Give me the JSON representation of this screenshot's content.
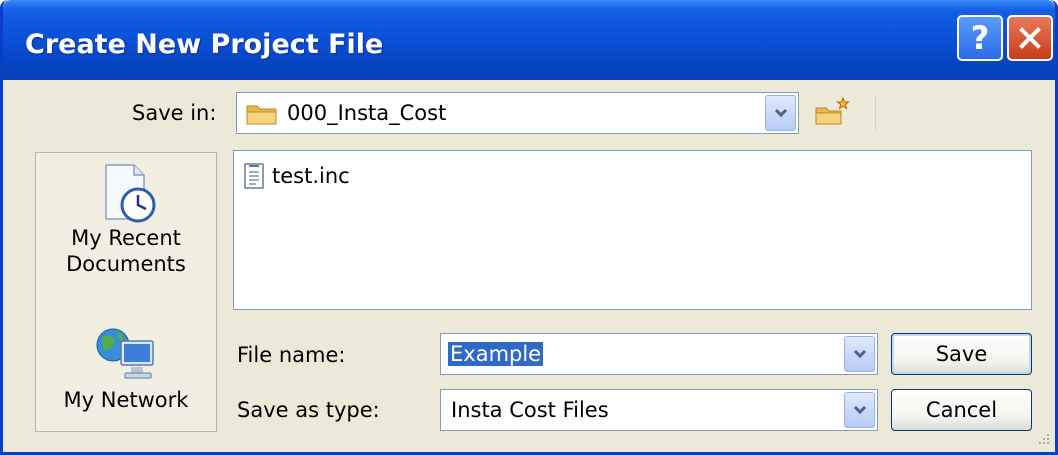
{
  "window": {
    "title": "Create New Project File",
    "help_label": "?",
    "colors": {
      "title_bar": "#0a52d8",
      "face": "#ece9d8",
      "selection": "#316ac5"
    }
  },
  "save_in": {
    "label": "Save in:",
    "value": "000_Insta_Cost",
    "icon": "folder-icon"
  },
  "toolbar": {
    "new_folder_icon": "new-folder-icon"
  },
  "places": [
    {
      "label_line1": "My Recent",
      "label_line2": "Documents",
      "icon": "recent-documents-icon"
    },
    {
      "label_line1": "My Network",
      "icon": "network-icon"
    }
  ],
  "files": [
    {
      "name": "test.inc",
      "icon": "text-file-icon"
    }
  ],
  "file_name": {
    "label": "File name:",
    "value": "Example"
  },
  "save_as_type": {
    "label": "Save as type:",
    "value": "Insta Cost Files"
  },
  "buttons": {
    "save_label": "Save",
    "cancel_label": "Cancel"
  }
}
